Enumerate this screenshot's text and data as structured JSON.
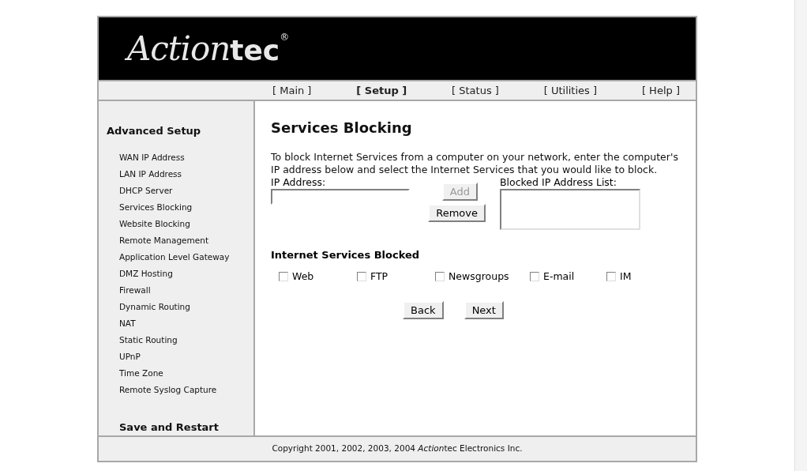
{
  "logo": {
    "script": "Action",
    "bold": "tec",
    "mark": "®"
  },
  "nav": [
    {
      "label": "[ Main ]",
      "selected": false
    },
    {
      "label": "[ Setup ]",
      "selected": true
    },
    {
      "label": "[ Status ]",
      "selected": false
    },
    {
      "label": "[ Utilities ]",
      "selected": false
    },
    {
      "label": "[ Help ]",
      "selected": false
    }
  ],
  "sidebar": {
    "heading": "Advanced Setup",
    "items": [
      "WAN IP Address",
      "LAN IP Address",
      "DHCP Server",
      "Services Blocking",
      "Website Blocking",
      "Remote Management",
      "Application Level Gateway",
      "DMZ Hosting",
      "Firewall",
      "Dynamic Routing",
      "NAT",
      "Static Routing",
      "UPnP",
      "Time Zone",
      "Remote Syslog Capture"
    ],
    "footer_link": "Save and Restart"
  },
  "content": {
    "title": "Services Blocking",
    "intro": "To block Internet Services from a computer on your network, enter the computer's IP address below and select the Internet Services that you would like to block.",
    "ip_label": "IP Address:",
    "add": {
      "label": "Add",
      "disabled": true
    },
    "remove": {
      "label": "Remove",
      "disabled": false
    },
    "list_label": "Blocked IP Address List:",
    "services_heading": "Internet Services Blocked",
    "services": [
      {
        "label": "Web",
        "checked": false
      },
      {
        "label": "FTP",
        "checked": false
      },
      {
        "label": "Newsgroups",
        "checked": false
      },
      {
        "label": "E-mail",
        "checked": false
      },
      {
        "label": "IM",
        "checked": false
      }
    ],
    "buttons": [
      "Back",
      "Next"
    ]
  },
  "footer": {
    "before": "Copyright 2001, 2002, 2003, 2004",
    "italic": "Action",
    "after": "tec Electronics Inc."
  }
}
